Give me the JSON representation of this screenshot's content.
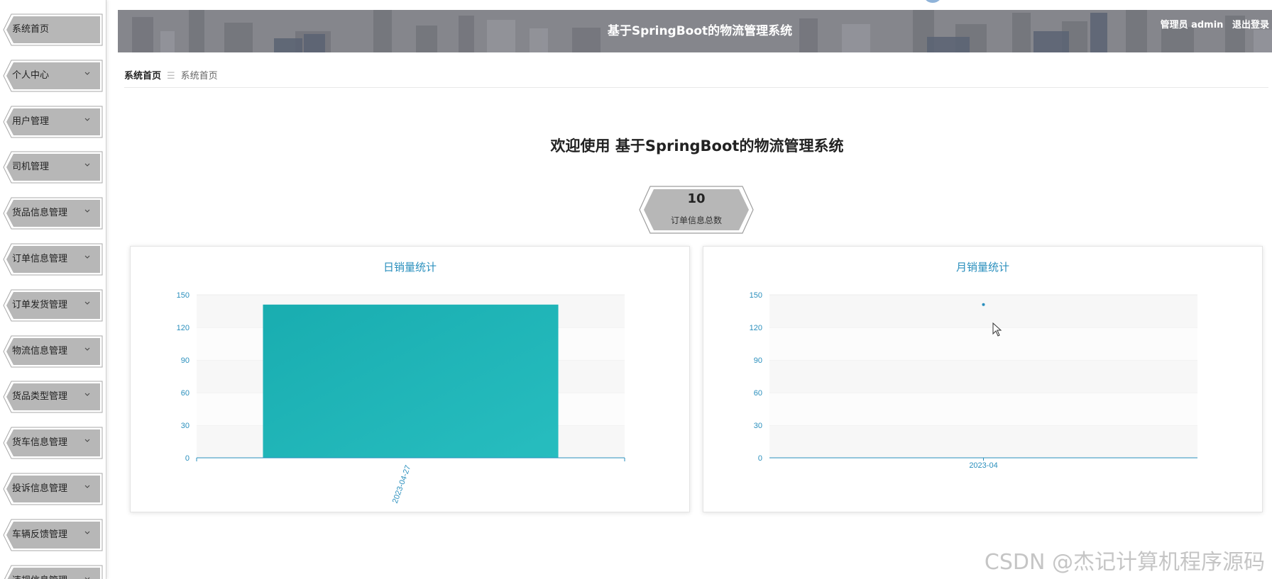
{
  "header": {
    "title": "基于SpringBoot的物流管理系统",
    "user_label": "管理员 admin",
    "logout_label": "退出登录"
  },
  "sidebar": {
    "items": [
      {
        "label": "系统首页",
        "has_arrow": false
      },
      {
        "label": "个人中心",
        "has_arrow": true
      },
      {
        "label": "用户管理",
        "has_arrow": true
      },
      {
        "label": "司机管理",
        "has_arrow": true
      },
      {
        "label": "货品信息管理",
        "has_arrow": true
      },
      {
        "label": "订单信息管理",
        "has_arrow": true
      },
      {
        "label": "订单发货管理",
        "has_arrow": true
      },
      {
        "label": "物流信息管理",
        "has_arrow": true
      },
      {
        "label": "货品类型管理",
        "has_arrow": true
      },
      {
        "label": "货车信息管理",
        "has_arrow": true
      },
      {
        "label": "投诉信息管理",
        "has_arrow": true
      },
      {
        "label": "车辆反馈管理",
        "has_arrow": true
      },
      {
        "label": "违规信息管理",
        "has_arrow": true
      }
    ]
  },
  "breadcrumb": {
    "home": "系统首页",
    "separator": "☰",
    "current": "系统首页"
  },
  "welcome": "欢迎使用 基于SpringBoot的物流管理系统",
  "stat": {
    "value": "10",
    "label": "订单信息总数"
  },
  "watermark": "CSDN @杰记计算机程序源码",
  "colors": {
    "accent": "#2a8fbd",
    "bar": "#20b2b4",
    "menu_bg": "#b7b7b7"
  },
  "chart_data": [
    {
      "type": "bar",
      "title": "日销量统计",
      "categories": [
        "2023-04-27"
      ],
      "values": [
        141
      ],
      "ylim": [
        0,
        150
      ],
      "yticks": [
        0,
        30,
        60,
        90,
        120,
        150
      ],
      "xlabel": "",
      "ylabel": "",
      "grid": true
    },
    {
      "type": "line",
      "title": "月销量统计",
      "categories": [
        "2023-04"
      ],
      "values": [
        141
      ],
      "ylim": [
        0,
        150
      ],
      "yticks": [
        0,
        30,
        60,
        90,
        120,
        150
      ],
      "xlabel": "",
      "ylabel": "",
      "grid": true
    }
  ]
}
